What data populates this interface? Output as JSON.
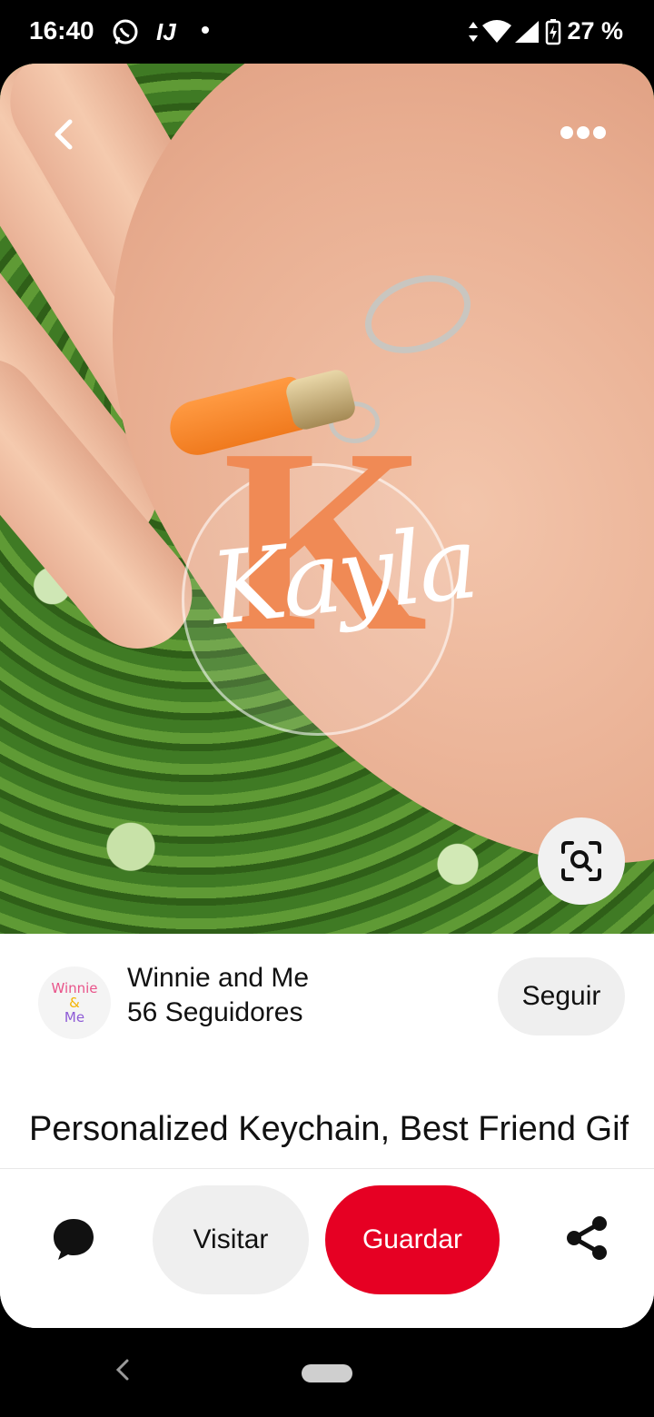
{
  "status_bar": {
    "time": "16:40",
    "battery_percent": "27 %",
    "icons": [
      "whatsapp-icon",
      "app-notification-icon",
      "dot-icon",
      "data-arrows-icon",
      "wifi-icon",
      "signal-icon",
      "battery-charging-icon"
    ]
  },
  "pin": {
    "image_text": {
      "letter": "K",
      "name": "Kayla"
    },
    "creator": {
      "avatar_text": [
        "Winnie",
        "&",
        "Me"
      ],
      "name": "Winnie and Me",
      "followers": "56 Seguidores",
      "follow_label": "Seguir"
    },
    "title": "Personalized Keychain, Best Friend Gift, Matching Gift, Monogram"
  },
  "actions": {
    "visit_label": "Visitar",
    "save_label": "Guardar"
  },
  "colors": {
    "save_red": "#e60023",
    "soft_button": "#efefef",
    "accent_orange": "#f08a55"
  }
}
